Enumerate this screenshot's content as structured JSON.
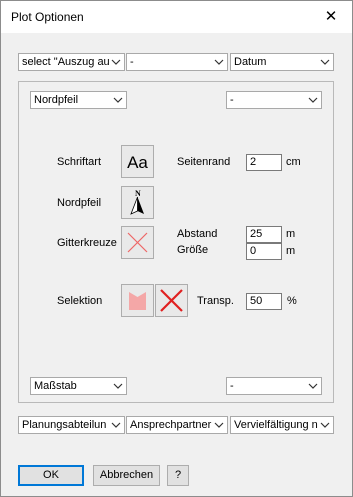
{
  "window": {
    "title": "Plot Optionen",
    "close_glyph": "✕"
  },
  "top_row": [
    {
      "value": "select \"Auszug au"
    },
    {
      "value": "-"
    },
    {
      "value": "Datum"
    }
  ],
  "panel": {
    "north_select": "Nordpfeil",
    "right_select_top": "-",
    "bottom_select": "Maßstab",
    "right_select_bottom": "-",
    "labels": {
      "schriftart": "Schriftart",
      "nordpfeil": "Nordpfeil",
      "gitterkreuze": "Gitterkreuze",
      "selektion": "Selektion",
      "seitenrand": "Seitenrand",
      "abstand": "Abstand",
      "groesse": "Größe",
      "transp": "Transp."
    },
    "font_button_text": "Aa",
    "north_glyph": "N",
    "values": {
      "seitenrand": "2",
      "abstand": "25",
      "groesse": "0",
      "transp": "50"
    },
    "units": {
      "seitenrand": "cm",
      "abstand": "m",
      "groesse": "m",
      "transp": "%"
    }
  },
  "bottom_row": [
    {
      "value": "Planungsabteilun"
    },
    {
      "value": "Ansprechpartner"
    },
    {
      "value": "Vervielfältigung n"
    }
  ],
  "buttons": {
    "ok": "OK",
    "cancel": "Abbrechen",
    "help": "?"
  },
  "colors": {
    "selection_swatch": "#f4a7a7",
    "cross_red": "#e02020"
  }
}
